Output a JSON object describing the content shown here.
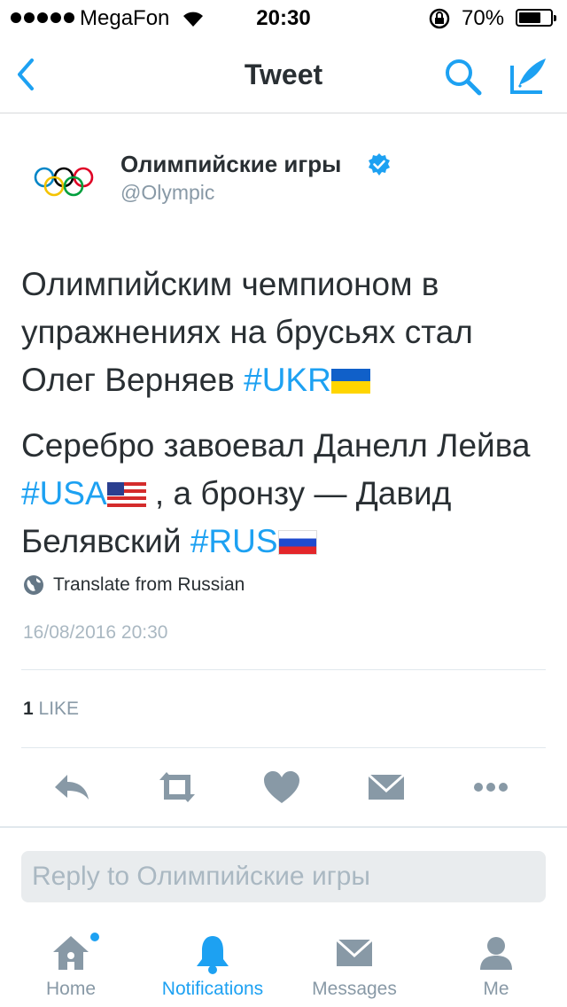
{
  "status_bar": {
    "carrier": "MegaFon",
    "time": "20:30",
    "battery_percent": "70%",
    "battery_level": 0.7,
    "signal_bars": 5
  },
  "nav": {
    "title": "Tweet",
    "back_icon": "chevron-left-icon",
    "search_icon": "search-icon",
    "compose_icon": "compose-icon"
  },
  "tweet": {
    "display_name": "Олимпийские игры",
    "username": "@Olympic",
    "verified": true,
    "paragraph1": {
      "text": "Олимпийским чемпионом в упражнениях на брусьях стал Олег Верняев ",
      "hashtag": "#UKR"
    },
    "paragraph2": {
      "text_a": "Серебро завоевал Данелл Лейва ",
      "hashtag_a": "#USA",
      "text_b": " , а бронзу — Давид Белявский ",
      "hashtag_b": "#RUS"
    },
    "translate_label": "Translate from Russian",
    "timestamp": "16/08/2016 20:30",
    "like_count": "1",
    "like_label": "LIKE"
  },
  "reply": {
    "placeholder": "Reply to Олимпийские игры"
  },
  "tabs": [
    {
      "label": "Home",
      "icon": "home-icon",
      "has_dot": true,
      "active": false
    },
    {
      "label": "Notifications",
      "icon": "bell-icon",
      "active": true
    },
    {
      "label": "Messages",
      "icon": "envelope-icon",
      "active": false
    },
    {
      "label": "Me",
      "icon": "person-icon",
      "active": false
    }
  ],
  "colors": {
    "accent": "#1da1f2",
    "icon_gray": "#8899a6",
    "text_dark": "#292f33"
  }
}
